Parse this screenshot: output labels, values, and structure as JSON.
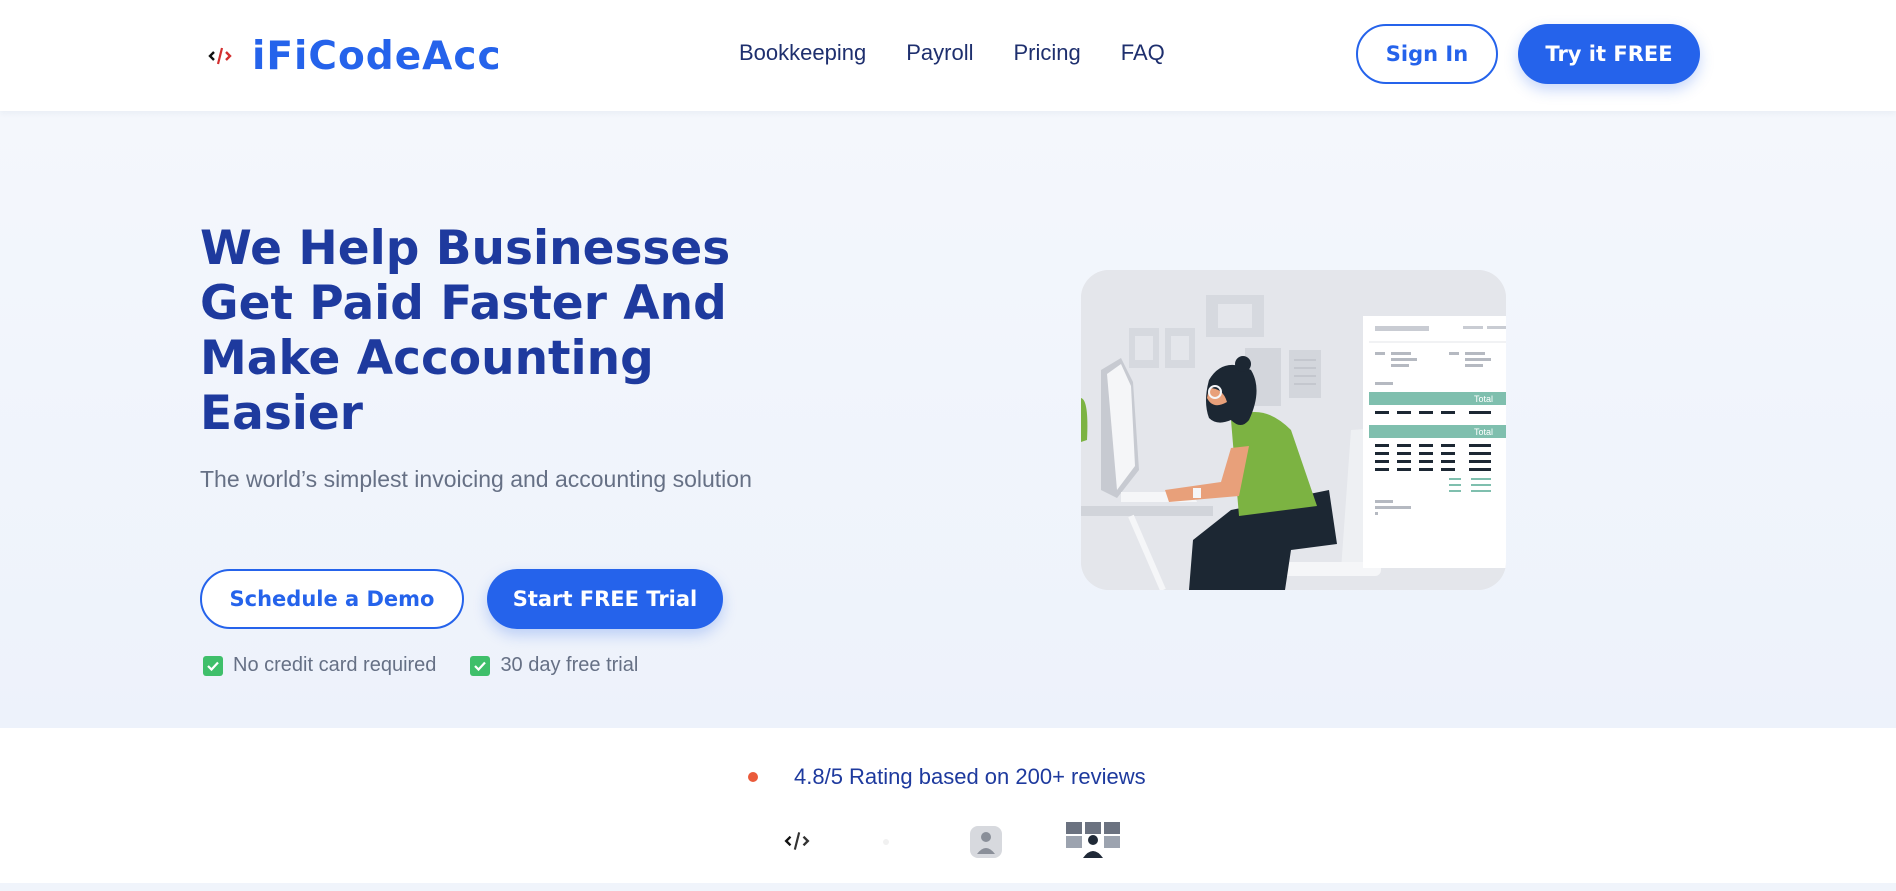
{
  "header": {
    "brand": "iFiCodeAcc",
    "nav": [
      "Bookkeeping",
      "Payroll",
      "Pricing",
      "FAQ"
    ],
    "sign_in": "Sign In",
    "try_free": "Try it FREE"
  },
  "hero": {
    "title_lines": [
      "We Help Businesses",
      "Get Paid Faster And",
      "Make Accounting",
      "Easier"
    ],
    "subtitle": "The world’s simplest invoicing and accounting solution",
    "demo_button": "Schedule a Demo",
    "trial_button": "Start FREE Trial",
    "checks": [
      "No credit card required",
      "30 day free trial"
    ],
    "illustration": {
      "invoice_labels": [
        "Total",
        "Total"
      ]
    }
  },
  "reviews": {
    "rating_text": "4.8/5 Rating based on 200+ reviews"
  },
  "colors": {
    "brand_blue": "#2563eb",
    "heading_navy": "#1e3a9e",
    "check_green": "#3fbf6a",
    "rating_dot": "#ea5a3a",
    "shirt_green": "#7cb342"
  },
  "icons": [
    "logo-mark-icon",
    "checkbox-icon",
    "rating-dot-icon",
    "partner-logo-icon"
  ]
}
